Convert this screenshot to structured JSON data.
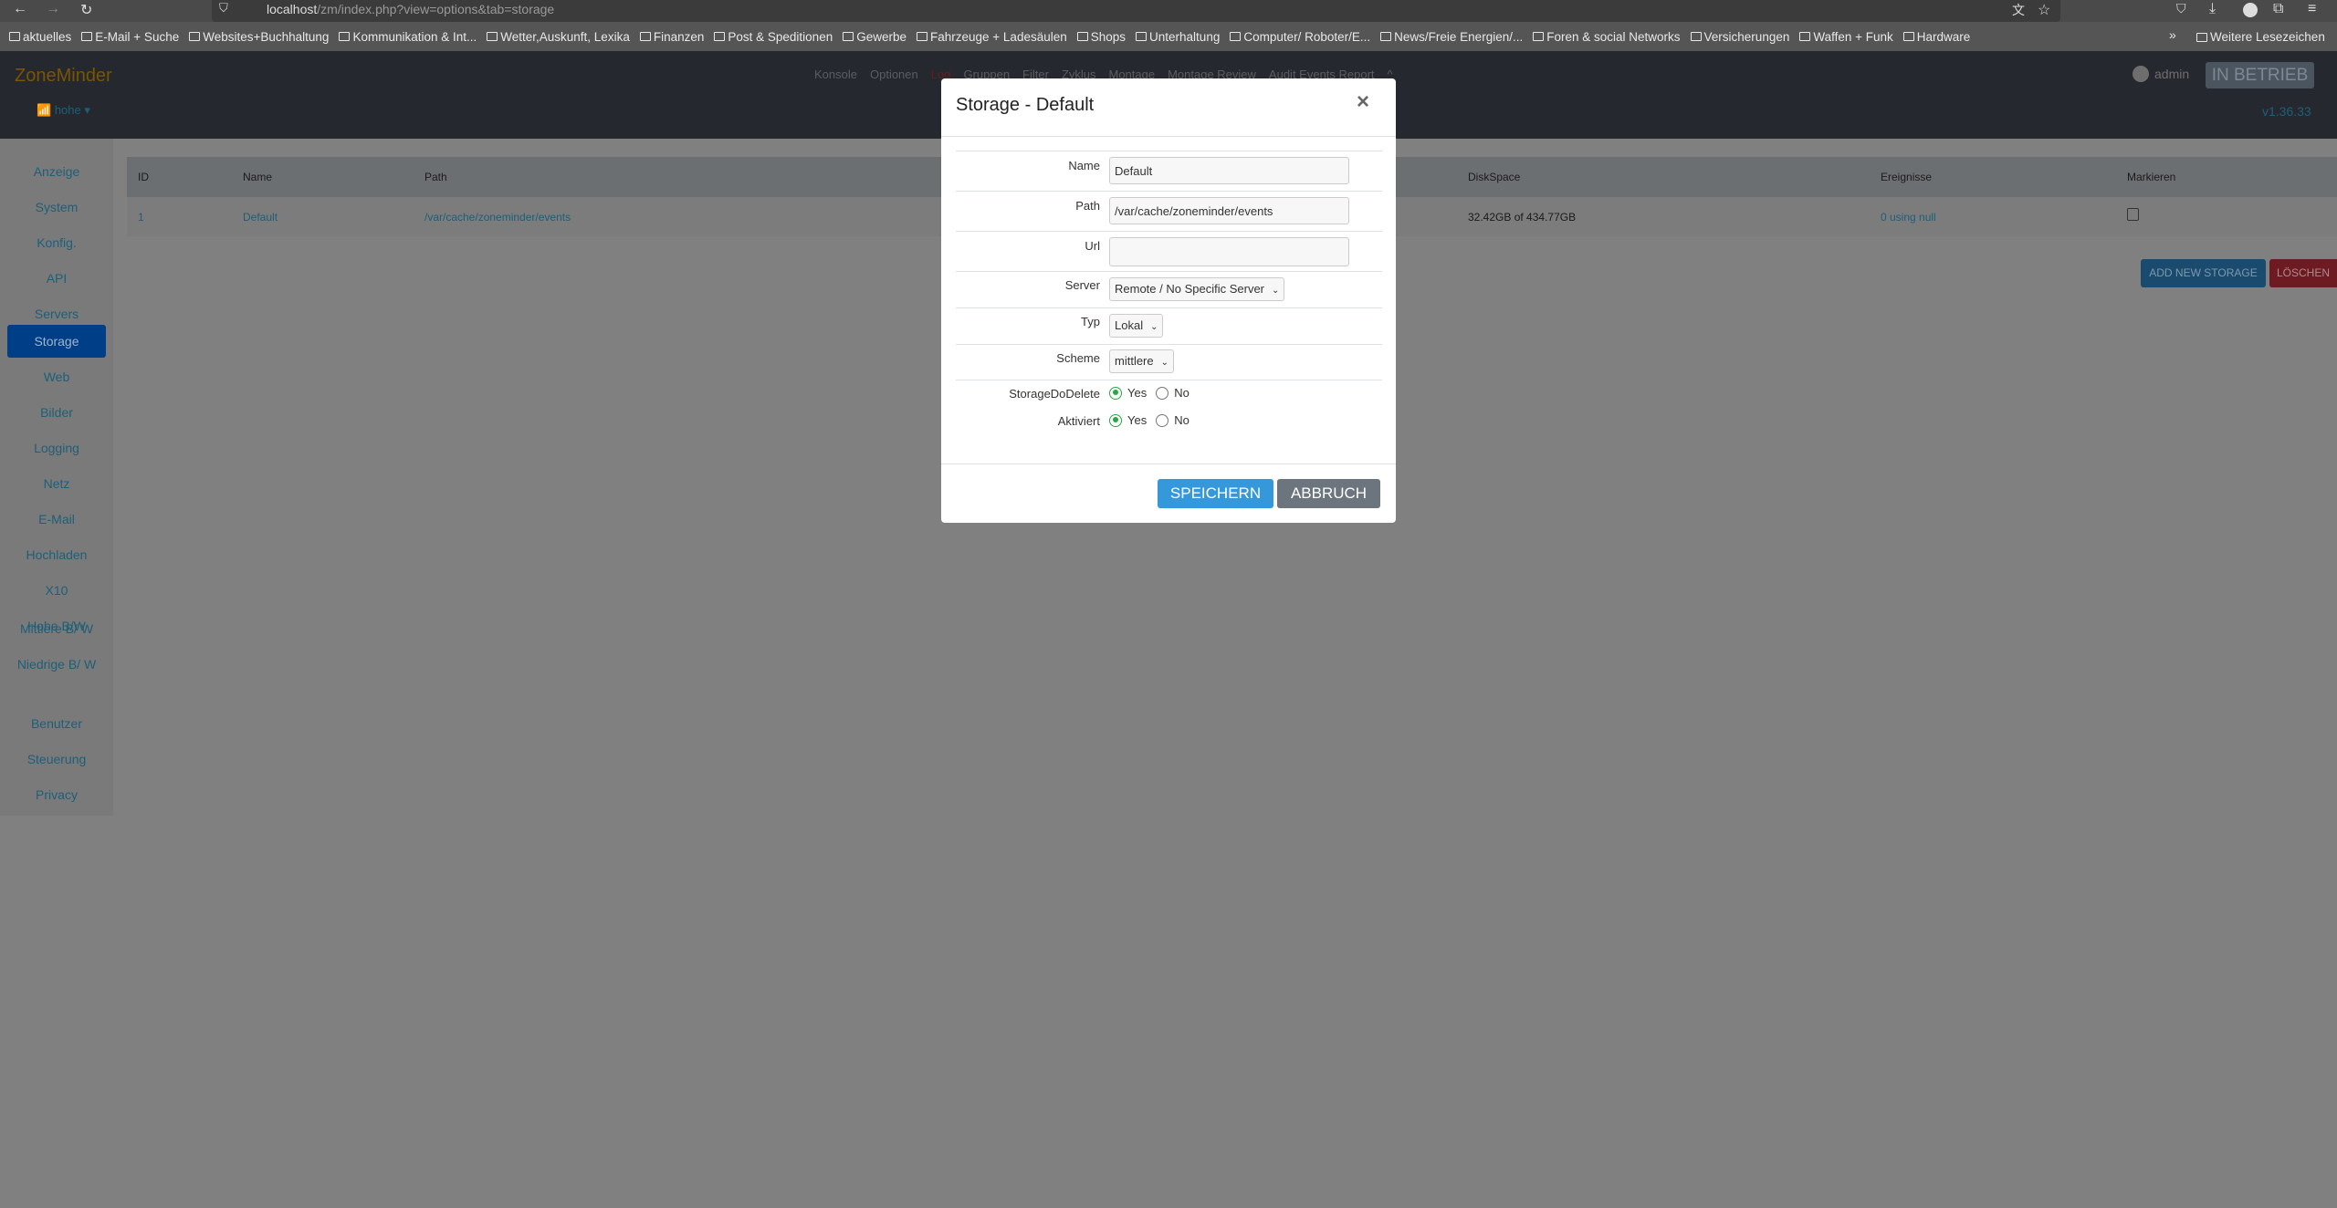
{
  "browser": {
    "url_host": "localhost",
    "url_path": "/zm/index.php?view=options&tab=storage",
    "bookmarks": [
      "aktuelles",
      "E-Mail + Suche",
      "Websites+Buchhaltung",
      "Kommunikation & Int...",
      "Wetter,Auskunft, Lexika",
      "Finanzen",
      "Post & Speditionen",
      "Gewerbe",
      "Fahrzeuge + Ladesäulen",
      "Shops",
      "Unterhaltung",
      "Computer/ Roboter/E...",
      "News/Freie Energien/...",
      "Foren & social Networks",
      "Versicherungen",
      "Waffen + Funk",
      "Hardware"
    ],
    "more_bookmarks": "Weitere Lesezeichen"
  },
  "header": {
    "brand": "ZoneMinder",
    "bandwidth": "hohe",
    "menu": [
      "Konsole",
      "Optionen",
      "Log",
      "Gruppen",
      "Filter",
      "Zyklus",
      "Montage",
      "Montage Review",
      "Audit Events Report",
      "^"
    ],
    "user": "admin",
    "status": "IN BETRIEB",
    "version": "v1.36.33"
  },
  "sidebar": {
    "items": [
      "Anzeige",
      "System",
      "Konfig.",
      "API",
      "Servers",
      "Storage",
      "Web",
      "Bilder",
      "Logging",
      "Netz",
      "E-Mail",
      "Hochladen",
      "X10",
      "Hohe B/W",
      "Mittlere B/ W",
      "Niedrige B/ W",
      "Benutzer",
      "Steuerung",
      "Privacy"
    ],
    "active": "Storage"
  },
  "table": {
    "headers": {
      "id": "ID",
      "name": "Name",
      "path": "Path",
      "diskspace": "DiskSpace",
      "events": "Ereignisse",
      "mark": "Markieren"
    },
    "rows": [
      {
        "id": "1",
        "name": "Default",
        "path": "/var/cache/zoneminder/events",
        "diskspace": "32.42GB of 434.77GB",
        "events": "0 using null",
        "marked": false
      }
    ]
  },
  "actions": {
    "add": "ADD NEW STORAGE",
    "delete": "LÖSCHEN"
  },
  "modal": {
    "title": "Storage - Default",
    "close": "×",
    "labels": {
      "name": "Name",
      "path": "Path",
      "url": "Url",
      "server": "Server",
      "type": "Typ",
      "scheme": "Scheme",
      "do_delete": "StorageDoDelete",
      "enabled": "Aktiviert"
    },
    "values": {
      "name": "Default",
      "path": "/var/cache/zoneminder/events",
      "url": "",
      "server": "Remote / No Specific Server",
      "type": "Lokal",
      "scheme": "mittlere",
      "do_delete": "Yes",
      "enabled": "Yes"
    },
    "yes": "Yes",
    "no": "No",
    "save": "SPEICHERN",
    "cancel": "ABBRUCH"
  },
  "colors": {
    "accent": "#3498db",
    "radio_checked": "#28a745",
    "active_nav": "#0056b3",
    "danger": "#dc3545"
  }
}
